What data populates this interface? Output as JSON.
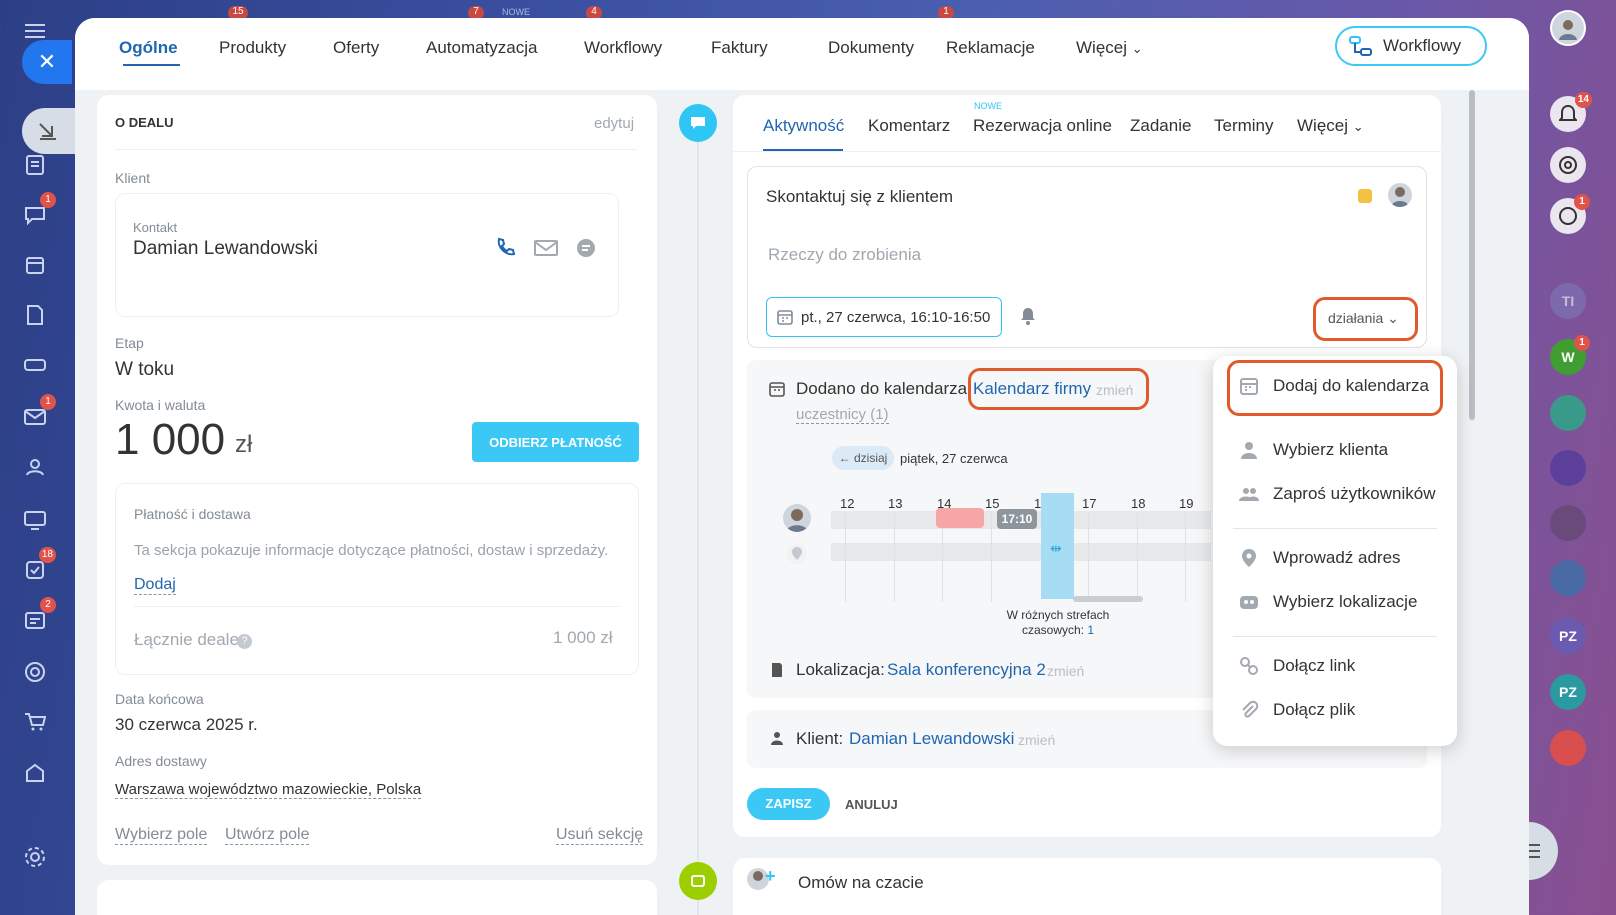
{
  "left_rail": {
    "badges": {
      "chat": "1",
      "mail": "1",
      "tasks": "18",
      "contacts": "2"
    },
    "top_counts": [
      "15",
      "7",
      "4",
      "1"
    ],
    "top_new": "NOWE"
  },
  "right_rail": {
    "notifications_badge": "14",
    "chat_badge": "1",
    "w_badge": "1",
    "avatars": [
      "TI",
      "W",
      "PZ",
      "PZ"
    ]
  },
  "topnav": {
    "tabs": [
      "Ogólne",
      "Produkty",
      "Oferty",
      "Automatyzacja",
      "Workflowy",
      "Faktury",
      "Dokumenty",
      "Reklamacje",
      "Więcej"
    ],
    "workflow_button": "Workflowy"
  },
  "deal": {
    "section_title": "O DEALU",
    "edit_link": "edytuj",
    "client_label": "Klient",
    "contact_label": "Kontakt",
    "contact_name": "Damian Lewandowski",
    "stage_label": "Etap",
    "stage_value": "W toku",
    "amount_label": "Kwota i waluta",
    "amount_value": "1 000",
    "currency": "zł",
    "pay_button": "ODBIERZ PŁATNOŚĆ",
    "payment_title": "Płatność i dostawa",
    "payment_desc": "Ta sekcja pokazuje informacje dotyczące płatności, dostaw i sprzedaży.",
    "add_link": "Dodaj",
    "total_label": "Łącznie deale",
    "total_value": "1 000 zł",
    "end_date_label": "Data końcowa",
    "end_date_value": "30 czerwca 2025 r.",
    "address_label": "Adres dostawy",
    "address_value": "Warszawa województwo mazowieckie, Polska",
    "footer_links": [
      "Wybierz pole",
      "Utwórz pole",
      "Usuń sekcję"
    ]
  },
  "activity": {
    "tabs": [
      "Aktywność",
      "Komentarz",
      "Rezerwacja online",
      "Zadanie",
      "Terminy",
      "Więcej"
    ],
    "new_badge": "NOWE",
    "todo_title": "Skontaktuj się z klientem",
    "todo_placeholder": "Rzeczy do zrobienia",
    "datetime": "pt., 27 czerwca, 16:10-16:50",
    "actions_label": "działania",
    "calendar_text": "Dodano do kalendarza",
    "calendar_name": "Kalendarz firmy",
    "change": "zmień",
    "participants": "uczestnicy (1)",
    "today_button": "← dzisiaj",
    "day_label": "piątek, 27 czerwca",
    "hours": [
      "12",
      "13",
      "14",
      "15",
      "16",
      "17",
      "18",
      "19"
    ],
    "time_marker": "17:10",
    "timezone_note_1": "W różnych strefach",
    "timezone_note_2": "czasowych:",
    "timezone_count": "1",
    "location_label": "Lokalizacja:",
    "location_value": "Sala konferencyjna 2",
    "client_label": "Klient:",
    "client_value": "Damian Lewandowski",
    "save_button": "ZAPISZ",
    "cancel_button": "ANULUJ",
    "chat_item": "Omów na czacie"
  },
  "menu": {
    "items": [
      "Dodaj do kalendarza",
      "Wybierz klienta",
      "Zaproś użytkowników",
      "Wprowadź adres",
      "Wybierz lokalizacje",
      "Dołącz link",
      "Dołącz plik"
    ]
  }
}
